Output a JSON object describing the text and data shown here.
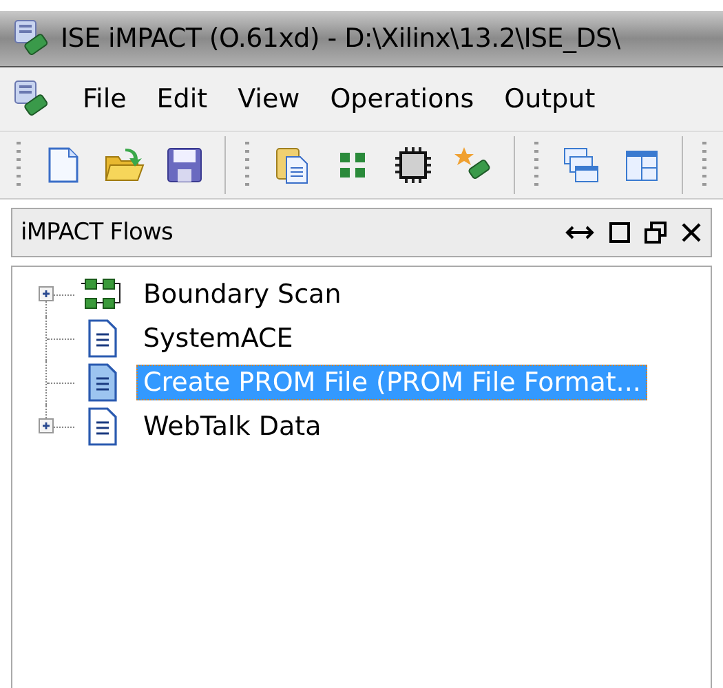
{
  "window": {
    "title": "ISE iMPACT (O.61xd) - D:\\Xilinx\\13.2\\ISE_DS\\"
  },
  "menu": [
    {
      "label": "File"
    },
    {
      "label": "Edit"
    },
    {
      "label": "View"
    },
    {
      "label": "Operations"
    },
    {
      "label": "Output"
    }
  ],
  "panel": {
    "title": "iMPACT Flows"
  },
  "tree": [
    {
      "label": "Boundary Scan",
      "kind": "chain",
      "has_children": true,
      "selected": false
    },
    {
      "label": "SystemACE",
      "kind": "document",
      "has_children": false,
      "selected": false
    },
    {
      "label": "Create PROM File (PROM File Format...",
      "kind": "document",
      "has_children": false,
      "selected": true
    },
    {
      "label": "WebTalk Data",
      "kind": "document",
      "has_children": true,
      "selected": false
    }
  ]
}
